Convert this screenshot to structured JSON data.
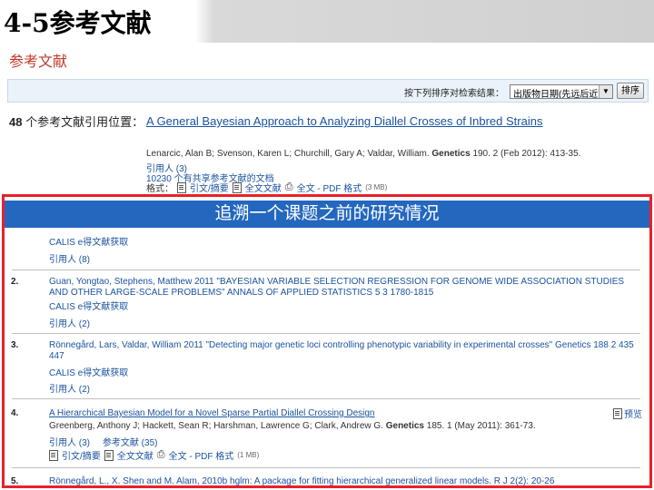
{
  "slide": {
    "title": "4-5参考文献"
  },
  "page": {
    "section_heading": "参考文献",
    "sort": {
      "label": "按下列排序对检索结果：",
      "selected": "出版物日期(先远后近)",
      "button": "排序"
    },
    "summary": {
      "count": "48",
      "count_label": "个参考文献引用位置："
    },
    "source": {
      "title": "A General Bayesian Approach to Analyzing Diallel Crosses of Inbred Strains",
      "authors": "Lenarcic, Alan B; Svenson, Karen L; Churchill, Gary A; Valdar, William.",
      "journal": "Genetics",
      "citation": "190. 2 (Feb 2012): 413-35.",
      "cited_by": "引用人 (3)",
      "shared_refs": "10230 个有共享参考文献的文档",
      "format_label": "格式：",
      "abstract_link": "引文/摘要",
      "fulltext_link": "全文文献",
      "pdf_link": "全文 - PDF 格式",
      "pdf_size": "(3 MB)"
    },
    "banner": "追溯一个课题之前的研究情况",
    "references": [
      {
        "num": "",
        "calis": "CALIS e得文献获取",
        "cited_by": "引用人 (8)"
      },
      {
        "num": "2.",
        "text": "Guan, Yongtao, Stephens, Matthew 2011 \"BAYESIAN VARIABLE SELECTION REGRESSION FOR GENOME WIDE ASSOCIATION STUDIES AND OTHER LARGE-SCALE PROBLEMS\" ANNALS OF APPLIED STATISTICS 5 3 1780-1815",
        "calis": "CALIS e得文献获取",
        "cited_by": "引用人 (2)"
      },
      {
        "num": "3.",
        "text": "Rönnegård, Lars, Valdar, William 2011 \"Detecting major genetic loci controlling phenotypic variability in experimental crosses\" Genetics 188 2 435 447",
        "calis": "CALIS e得文献获取",
        "cited_by": "引用人 (2)"
      },
      {
        "num": "4.",
        "title": "A Hierarchical Bayesian Model for a Novel Sparse Partial Diallel Crossing Design",
        "authors": "Greenberg, Anthony J; Hackett, Sean R; Harshman, Lawrence G; Clark, Andrew G.",
        "journal": "Genetics",
        "citation": "185. 1 (May 2011): 361-73.",
        "preview": "预览",
        "cited_by": "引用人 (3)",
        "refs": "参考文献 (35)",
        "abstract_link": "引文/摘要",
        "fulltext_link": "全文文献",
        "pdf_link": "全文 - PDF 格式",
        "pdf_size": "(1 MB)"
      },
      {
        "num": "5.",
        "text": "Rönnegård, L., X. Shen and M. Alam, 2010b hglm: A package for fitting hierarchical generalized linear models. R J 2(2): 20-26"
      }
    ]
  }
}
